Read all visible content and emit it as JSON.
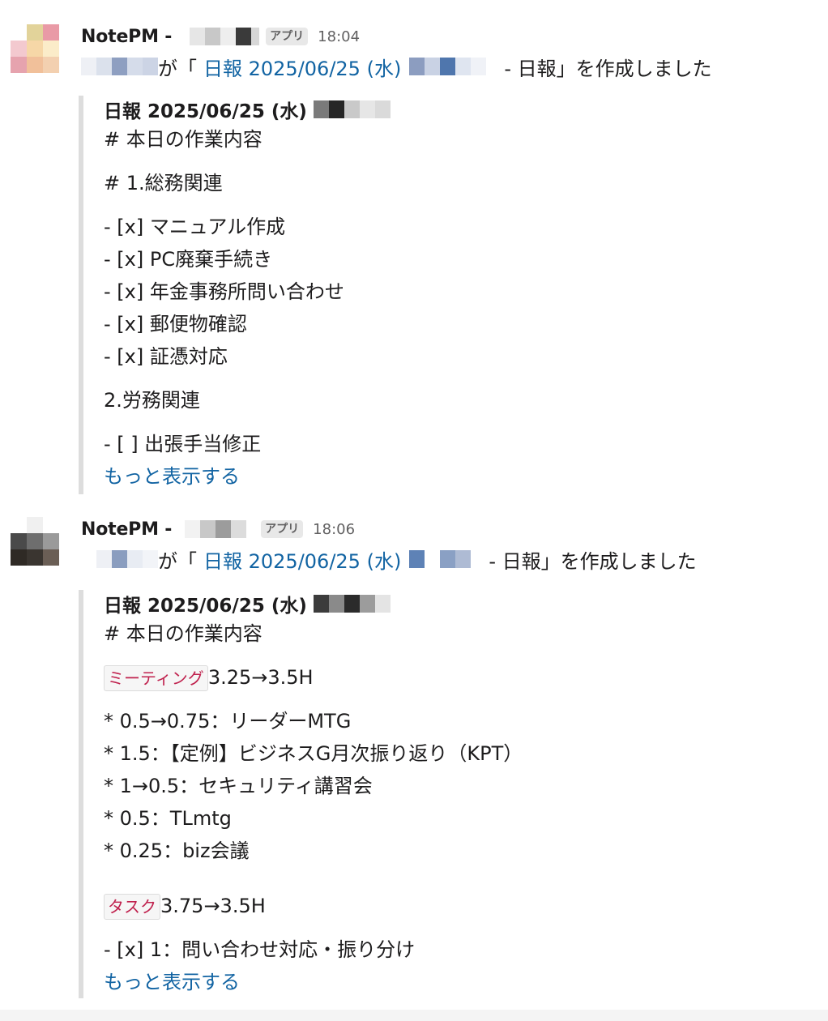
{
  "messages": [
    {
      "sender_name": "NotePM -",
      "app_badge": "アプリ",
      "time": "18:04",
      "text_ga": "が「",
      "link_text": "日報 2025/06/25 (水)",
      "text_tail": "- 日報」を作成しました",
      "attachment": {
        "title": "日報 2025/06/25 (水)",
        "lines": [
          "# 本日の作業内容",
          "",
          "# 1.総務関連",
          "",
          "- [x] マニュアル作成",
          "- [x] PC廃棄手続き",
          "- [x] 年金事務所問い合わせ",
          "- [x] 郵便物確認",
          "- [x] 証憑対応",
          "",
          "2.労務関連",
          "",
          "- [ ] 出張手当修正"
        ],
        "more": "もっと表示する"
      }
    },
    {
      "sender_name": "NotePM -",
      "app_badge": "アプリ",
      "time": "18:06",
      "text_ga": "が「",
      "link_text": "日報 2025/06/25 (水)",
      "text_tail": "- 日報」を作成しました",
      "attachment": {
        "title": "日報 2025/06/25 (水)",
        "heading": "# 本日の作業内容",
        "tag_meeting": "ミーティング",
        "meeting_hours": "3.25→3.5H",
        "meeting_items": [
          "* 0.5→0.75：リーダーMTG",
          "* 1.5：【定例】ビジネスG月次振り返り（KPT）",
          "* 1→0.5：セキュリティ講習会",
          "* 0.5：TLmtg",
          "* 0.25：biz会議"
        ],
        "tag_task": "タスク",
        "task_hours": "3.75→3.5H",
        "task_items": [
          "- [x] 1：問い合わせ対応・振り分け"
        ],
        "more": "もっと表示する"
      }
    }
  ],
  "colors": {
    "link": "#1264a3",
    "tag_text": "#c0224e",
    "attachment_bar": "#dddddd"
  }
}
